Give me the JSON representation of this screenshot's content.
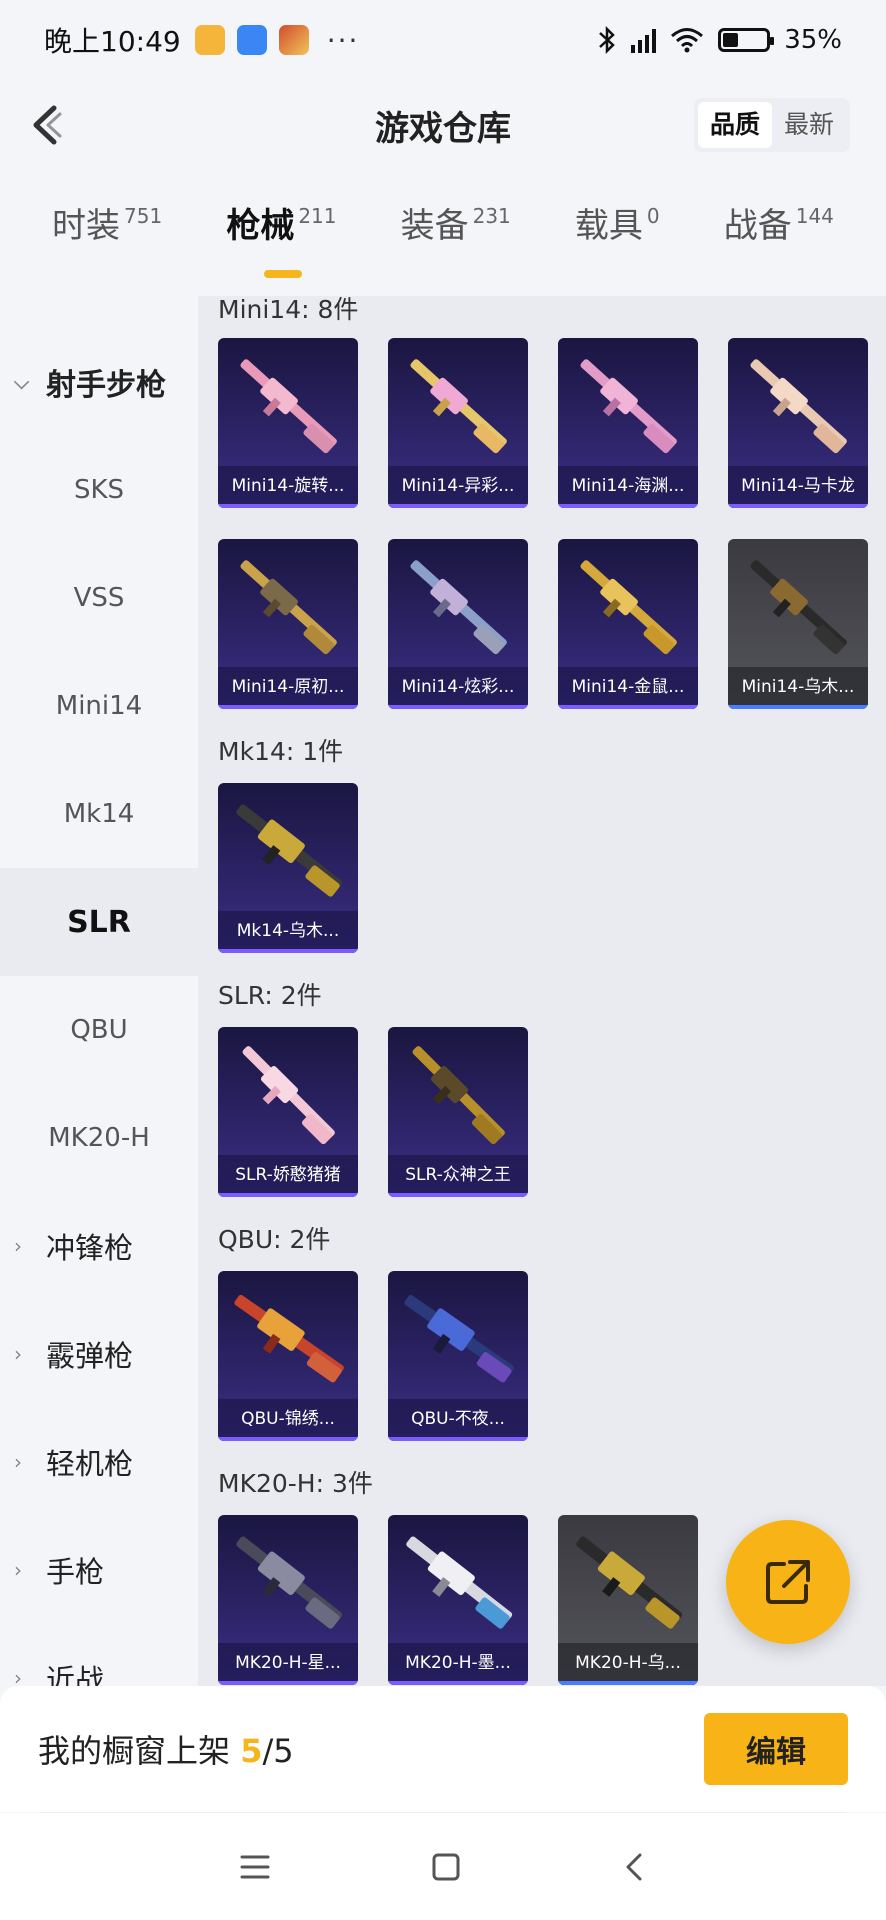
{
  "status": {
    "time": "晚上10:49",
    "more": "···",
    "battery_text": "35%",
    "battery_level": 0.35
  },
  "header": {
    "title": "游戏仓库",
    "sort_options": [
      "品质",
      "最新"
    ],
    "sort_active": "品质"
  },
  "tabs": [
    {
      "label": "时装",
      "count": "751"
    },
    {
      "label": "枪械",
      "count": "211",
      "active": true
    },
    {
      "label": "装备",
      "count": "231"
    },
    {
      "label": "载具",
      "count": "0"
    },
    {
      "label": "战备",
      "count": "144"
    }
  ],
  "sidebar": {
    "open_group": "射手步枪",
    "items": [
      "SKS",
      "VSS",
      "Mini14",
      "Mk14",
      "SLR",
      "QBU",
      "MK20-H"
    ],
    "active_item": "SLR",
    "closed_groups": [
      "冲锋枪",
      "霰弹枪",
      "轻机枪",
      "手枪",
      "近战"
    ]
  },
  "sections": [
    {
      "title": "Mini14: 8件",
      "cards": [
        {
          "label": "Mini14-旋转...",
          "tone": "purple"
        },
        {
          "label": "Mini14-异彩...",
          "tone": "purple"
        },
        {
          "label": "Mini14-海渊...",
          "tone": "purple"
        },
        {
          "label": "Mini14-马卡龙",
          "tone": "purple"
        },
        {
          "label": "Mini14-原初...",
          "tone": "purple"
        },
        {
          "label": "Mini14-炫彩...",
          "tone": "purple"
        },
        {
          "label": "Mini14-金鼠...",
          "tone": "purple"
        },
        {
          "label": "Mini14-乌木...",
          "tone": "gray"
        }
      ]
    },
    {
      "title": "Mk14: 1件",
      "cards": [
        {
          "label": "Mk14-乌木...",
          "tone": "purple"
        }
      ]
    },
    {
      "title": "SLR: 2件",
      "cards": [
        {
          "label": "SLR-娇憨猪猪",
          "tone": "purple"
        },
        {
          "label": "SLR-众神之王",
          "tone": "purple"
        }
      ]
    },
    {
      "title": "QBU: 2件",
      "cards": [
        {
          "label": "QBU-锦绣...",
          "tone": "purple"
        },
        {
          "label": "QBU-不夜...",
          "tone": "purple"
        }
      ]
    },
    {
      "title": "MK20-H: 3件",
      "cards": [
        {
          "label": "MK20-H-星...",
          "tone": "purple"
        },
        {
          "label": "MK20-H-墨...",
          "tone": "purple"
        },
        {
          "label": "MK20-H-乌...",
          "tone": "gray"
        }
      ]
    }
  ],
  "bottom": {
    "label": "我的橱窗上架",
    "used": "5",
    "separator": "/",
    "total": "5",
    "edit_label": "编辑"
  },
  "colors": {
    "accent": "#f8b316",
    "card_purple": "#2c2366",
    "card_gray": "#4a4a50",
    "rarity_bar": "#7b5cff"
  },
  "icons": {
    "back": "chevron-left-icon",
    "fab": "share-icon",
    "nav": [
      "menu-icon",
      "home-icon",
      "back-icon"
    ]
  }
}
